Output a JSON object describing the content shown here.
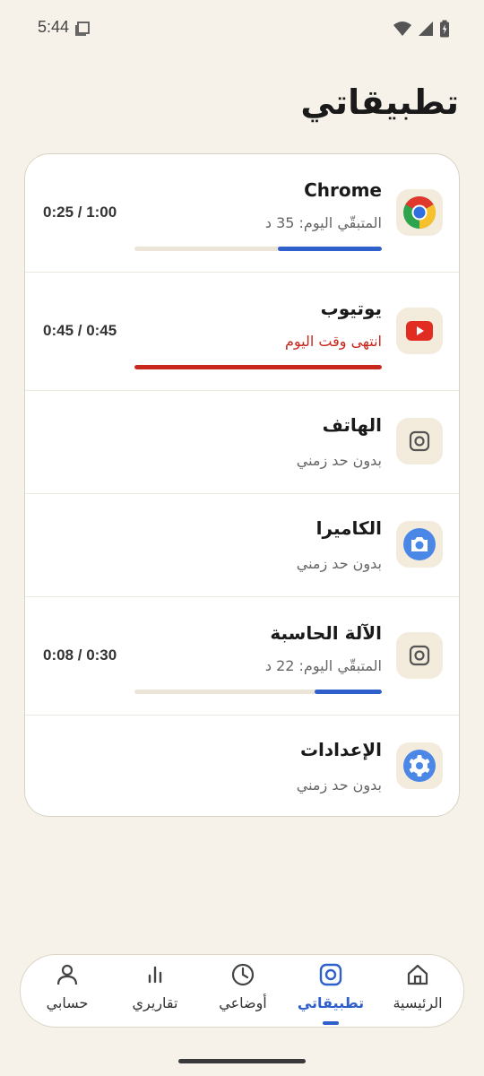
{
  "status": {
    "time": "5:44"
  },
  "page": {
    "title": "تطبيقاتي"
  },
  "apps": [
    {
      "name": "Chrome",
      "icon": "chrome-icon",
      "subtitle": "المتبقّي اليوم: 35 د",
      "usage": "0:25  /  1:00",
      "progress": 0.42,
      "state": "limited"
    },
    {
      "name": "يوتيوب",
      "icon": "youtube-icon",
      "subtitle": "انتهى وقت اليوم",
      "usage": "0:45  /  0:45",
      "progress": 1.0,
      "state": "expired"
    },
    {
      "name": "الهاتف",
      "icon": "app-generic-icon",
      "subtitle": "بدون حد زمني",
      "state": "unlimited"
    },
    {
      "name": "الكاميرا",
      "icon": "camera-icon",
      "subtitle": "بدون حد زمني",
      "state": "unlimited"
    },
    {
      "name": "الآلة الحاسبة",
      "icon": "app-generic-icon",
      "subtitle": "المتبقّي اليوم: 22 د",
      "usage": "0:08  /  0:30",
      "progress": 0.27,
      "state": "limited"
    },
    {
      "name": "الإعدادات",
      "icon": "settings-icon",
      "subtitle": "بدون حد زمني",
      "state": "unlimited"
    }
  ],
  "nav": {
    "items": [
      {
        "label": "الرئيسية",
        "icon": "home-icon"
      },
      {
        "label": "تطبيقاتي",
        "icon": "apps-icon",
        "active": true
      },
      {
        "label": "أوضاعي",
        "icon": "clock-icon"
      },
      {
        "label": "تقاريري",
        "icon": "bar-chart-icon"
      },
      {
        "label": "حسابي",
        "icon": "person-icon"
      }
    ]
  },
  "colors": {
    "background": "#f6f2e9",
    "accent": "#2f5fcb",
    "expired": "#c8271e",
    "icon_tile": "#f3ecdd"
  }
}
